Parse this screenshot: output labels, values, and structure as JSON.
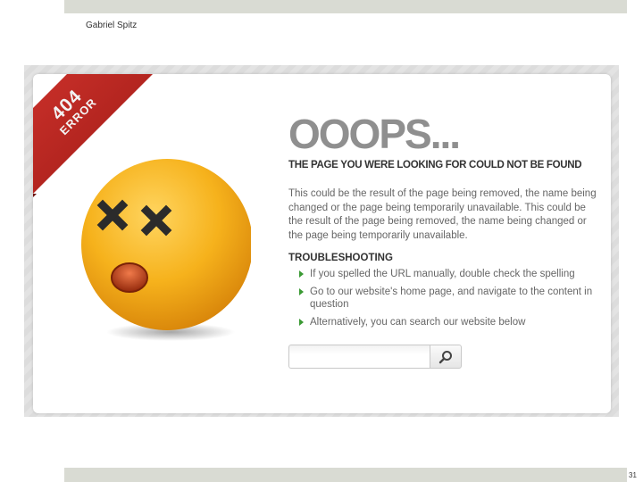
{
  "slide": {
    "author": "Gabriel Spitz",
    "page_number": "31"
  },
  "error_page": {
    "ribbon": {
      "code": "404",
      "label": "ERROR"
    },
    "headline": "OOOPS...",
    "subheadline": "THE PAGE YOU WERE LOOKING FOR COULD NOT BE FOUND",
    "description": "This could be the result of the page being removed, the name being changed or the page being temporarily unavailable. This could be the result of the page being removed, the name being changed or the page being temporarily unavailable.",
    "troubleshooting": {
      "title": "TROUBLESHOOTING",
      "items": [
        "If you spelled the URL manually, double check the spelling",
        "Go to our website's home page, and navigate to the content in question",
        "Alternatively, you can search our website below"
      ]
    },
    "search": {
      "value": "",
      "placeholder": ""
    },
    "icons": {
      "mascot": "dead-smiley-face-icon",
      "search": "magnifier-icon",
      "bullet": "green-triangle-bullet-icon"
    },
    "colors": {
      "ribbon": "#b5211b",
      "headline": "#8f8f8f",
      "bullet": "#3b9a34",
      "face": "#f5b21a"
    }
  }
}
